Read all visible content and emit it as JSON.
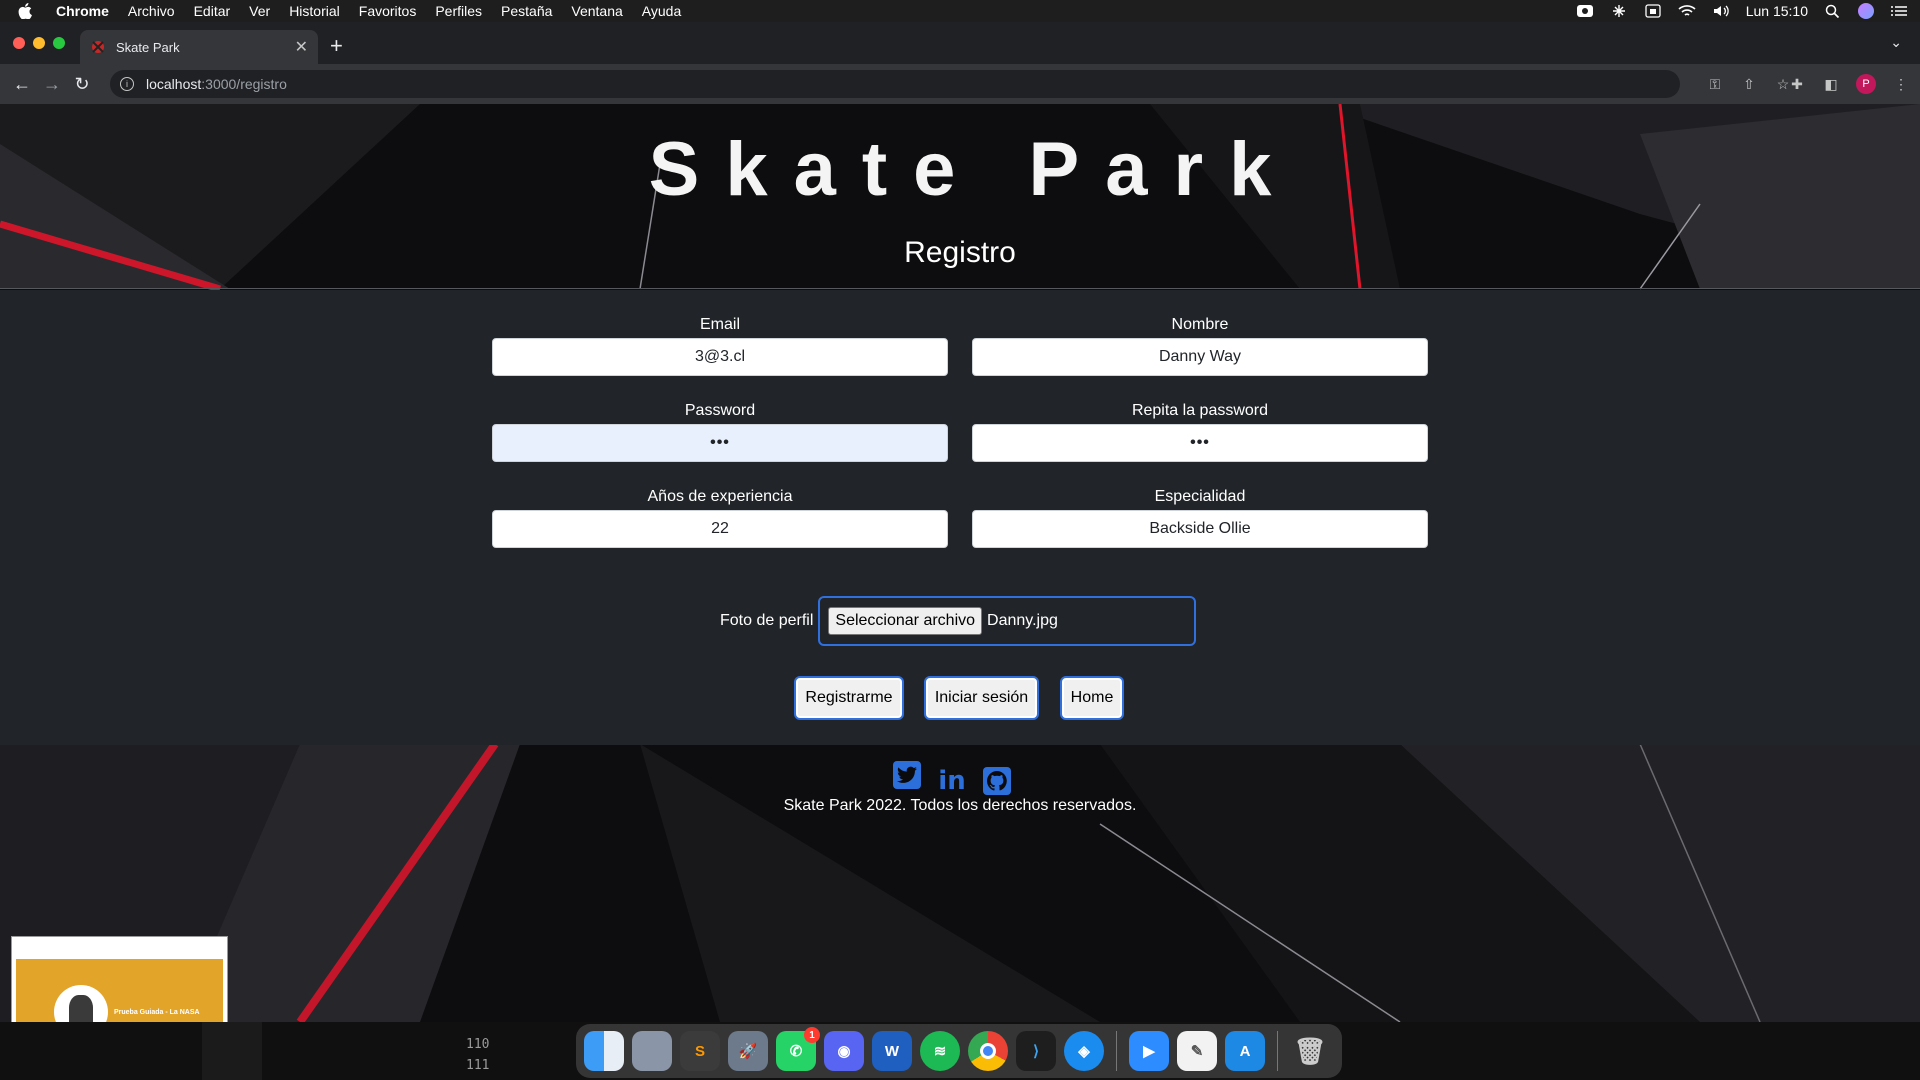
{
  "menubar": {
    "app": "Chrome",
    "items": [
      "Archivo",
      "Editar",
      "Ver",
      "Historial",
      "Favoritos",
      "Perfiles",
      "Pestaña",
      "Ventana",
      "Ayuda"
    ],
    "clock": "Lun 15:10"
  },
  "browser": {
    "tab_title": "Skate Park",
    "url_host": "localhost",
    "url_path": ":3000/registro",
    "profile_initial": "P"
  },
  "page": {
    "site_title": "Skate Park",
    "heading": "Registro",
    "fields": {
      "email": {
        "label": "Email",
        "value": "3@3.cl"
      },
      "nombre": {
        "label": "Nombre",
        "value": "Danny Way"
      },
      "password": {
        "label": "Password",
        "value": "•••"
      },
      "password2": {
        "label": "Repita la password",
        "value": "•••"
      },
      "experiencia": {
        "label": "Años de experiencia",
        "value": "22"
      },
      "especialidad": {
        "label": "Especialidad",
        "value": "Backside Ollie"
      }
    },
    "photo": {
      "label": "Foto de perfil",
      "button": "Seleccionar archivo",
      "filename": "Danny.jpg"
    },
    "buttons": {
      "register": "Registrarme",
      "login": "Iniciar sesión",
      "home": "Home"
    },
    "footer": {
      "copyright": "Skate Park 2022. Todos los derechos reservados."
    }
  },
  "pip": {
    "caption": "Prueba Guiada - La NASA"
  },
  "dock": {
    "code_lines": [
      "110",
      "111"
    ],
    "whatsapp_badge": "1"
  },
  "colors": {
    "accent_blue": "#2f6fde",
    "form_bg": "#212529",
    "red_streak": "#e0142a"
  }
}
